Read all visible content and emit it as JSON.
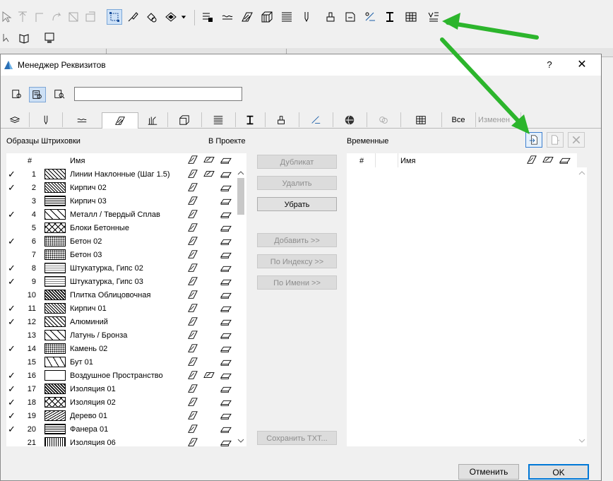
{
  "dialog": {
    "title": "Менеджер Реквизитов",
    "help": "?",
    "close": "✕",
    "search_value": "",
    "tabs_text": {
      "all": "Все",
      "changed": "Изменен"
    },
    "left_heading": "Образцы Штриховки",
    "project_heading": "В Проекте",
    "right_heading": "Временные",
    "col_num": "#",
    "col_name": "Имя"
  },
  "middle_buttons": {
    "duplicate": "Дубликат",
    "delete": "Удалить",
    "remove": "Убрать",
    "add": "Добавить >>",
    "by_index": "По Индексу >>",
    "by_name": "По Имени >>",
    "save_txt": "Сохранить TXT..."
  },
  "footer": {
    "cancel": "Отменить",
    "ok": "OK"
  },
  "rows": [
    {
      "checked": "✓",
      "num": "1",
      "name": "Линии Наклонные (Шаг 1.5)",
      "pattern": "diag"
    },
    {
      "checked": "✓",
      "num": "2",
      "name": "Кирпич 02",
      "pattern": "brick"
    },
    {
      "checked": "",
      "num": "3",
      "name": "Кирпич 03",
      "pattern": "grid"
    },
    {
      "checked": "✓",
      "num": "4",
      "name": "Металл / Твердый Сплав",
      "pattern": "wide"
    },
    {
      "checked": "",
      "num": "5",
      "name": "Блоки Бетонные",
      "pattern": "cross"
    },
    {
      "checked": "✓",
      "num": "6",
      "name": "Бетон 02",
      "pattern": "dots"
    },
    {
      "checked": "",
      "num": "7",
      "name": "Бетон 03",
      "pattern": "dots"
    },
    {
      "checked": "✓",
      "num": "8",
      "name": "Штукатурка, Гипс 02",
      "pattern": "fine"
    },
    {
      "checked": "✓",
      "num": "9",
      "name": "Штукатурка, Гипс 03",
      "pattern": "fine"
    },
    {
      "checked": "",
      "num": "10",
      "name": "Плитка Облицовочная",
      "pattern": "check"
    },
    {
      "checked": "✓",
      "num": "11",
      "name": "Кирпич 01",
      "pattern": "brick"
    },
    {
      "checked": "✓",
      "num": "12",
      "name": "Алюминий",
      "pattern": "diag"
    },
    {
      "checked": "",
      "num": "13",
      "name": "Латунь / Бронза",
      "pattern": "wide"
    },
    {
      "checked": "✓",
      "num": "14",
      "name": "Камень 02",
      "pattern": "dots"
    },
    {
      "checked": "",
      "num": "15",
      "name": "Бут 01",
      "pattern": "stone"
    },
    {
      "checked": "✓",
      "num": "16",
      "name": "Воздушное Пространство",
      "pattern": "empty"
    },
    {
      "checked": "✓",
      "num": "17",
      "name": "Изоляция 01",
      "pattern": "check"
    },
    {
      "checked": "✓",
      "num": "18",
      "name": "Изоляция 02",
      "pattern": "cross"
    },
    {
      "checked": "✓",
      "num": "19",
      "name": "Дерево 01",
      "pattern": "wood"
    },
    {
      "checked": "✓",
      "num": "20",
      "name": "Фанера 01",
      "pattern": "horiz"
    },
    {
      "checked": "",
      "num": "21",
      "name": "Изоляция 06",
      "pattern": "wave"
    }
  ],
  "colors": {
    "arrow": "#2cb52c",
    "selection": "#cde0f5",
    "ok_border": "#0078d7"
  }
}
